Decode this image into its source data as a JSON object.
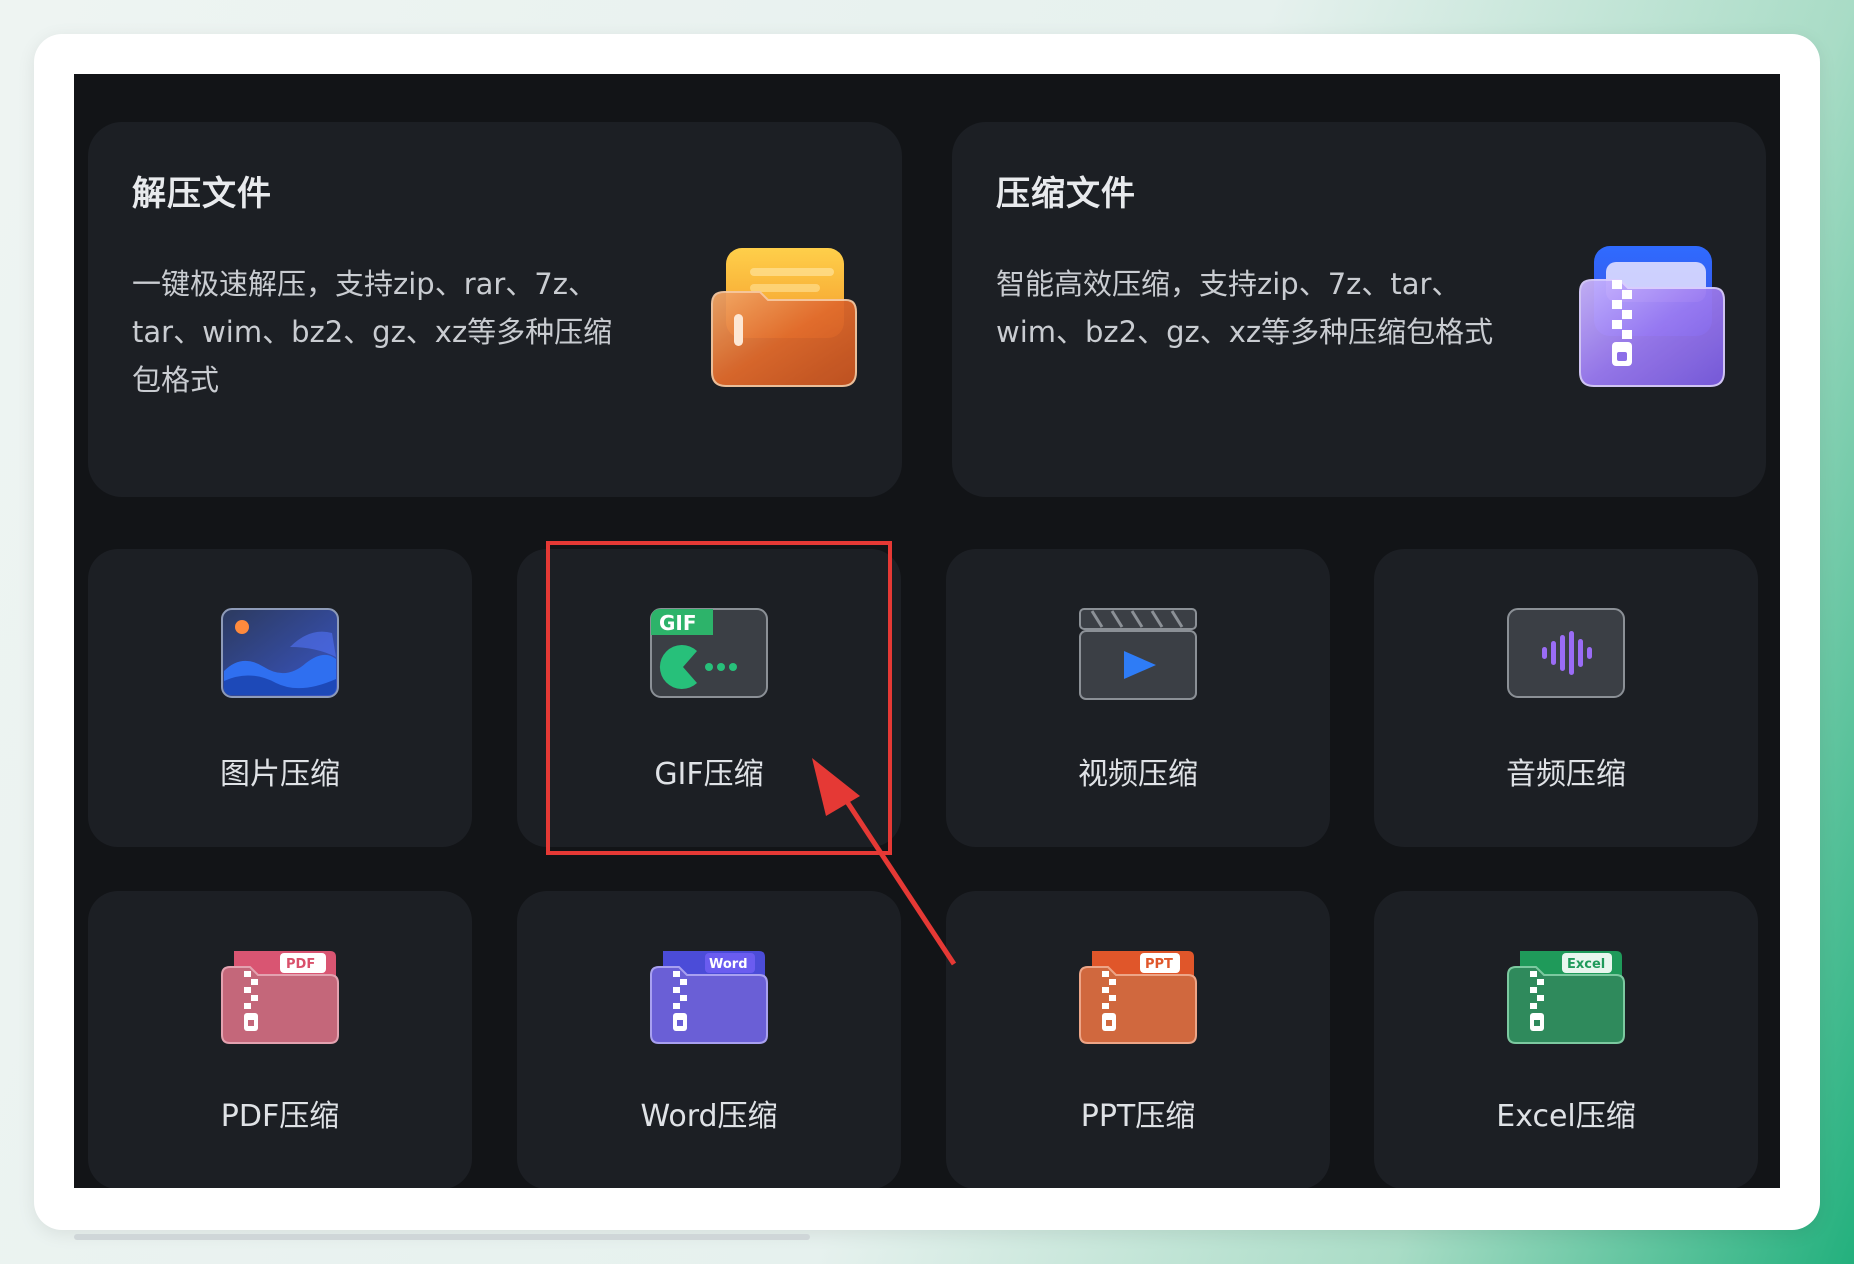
{
  "decompress_card": {
    "title": "解压文件",
    "description": "一键极速解压，支持zip、rar、7z、tar、wim、bz2、gz、xz等多种压缩包格式",
    "icon": "orange-folder-icon"
  },
  "compress_card": {
    "title": "压缩文件",
    "description": "智能高效压缩，支持zip、7z、tar、wim、bz2、gz、xz等多种压缩包格式",
    "icon": "purple-zip-folder-icon"
  },
  "tools": [
    {
      "label": "图片压缩",
      "icon": "image-icon"
    },
    {
      "label": "GIF压缩",
      "icon": "gif-icon",
      "icon_badge": "GIF"
    },
    {
      "label": "视频压缩",
      "icon": "video-clapper-icon"
    },
    {
      "label": "音频压缩",
      "icon": "audio-wave-icon"
    },
    {
      "label": "PDF压缩",
      "icon": "pdf-zip-icon",
      "icon_badge": "PDF"
    },
    {
      "label": "Word压缩",
      "icon": "word-zip-icon",
      "icon_badge": "Word"
    },
    {
      "label": "PPT压缩",
      "icon": "ppt-zip-icon",
      "icon_badge": "PPT"
    },
    {
      "label": "Excel压缩",
      "icon": "excel-zip-icon",
      "icon_badge": "Excel"
    }
  ],
  "colors": {
    "background": "#121417",
    "card": "#1c1f24",
    "highlight": "#e53935",
    "accent_green": "#23b07d"
  }
}
